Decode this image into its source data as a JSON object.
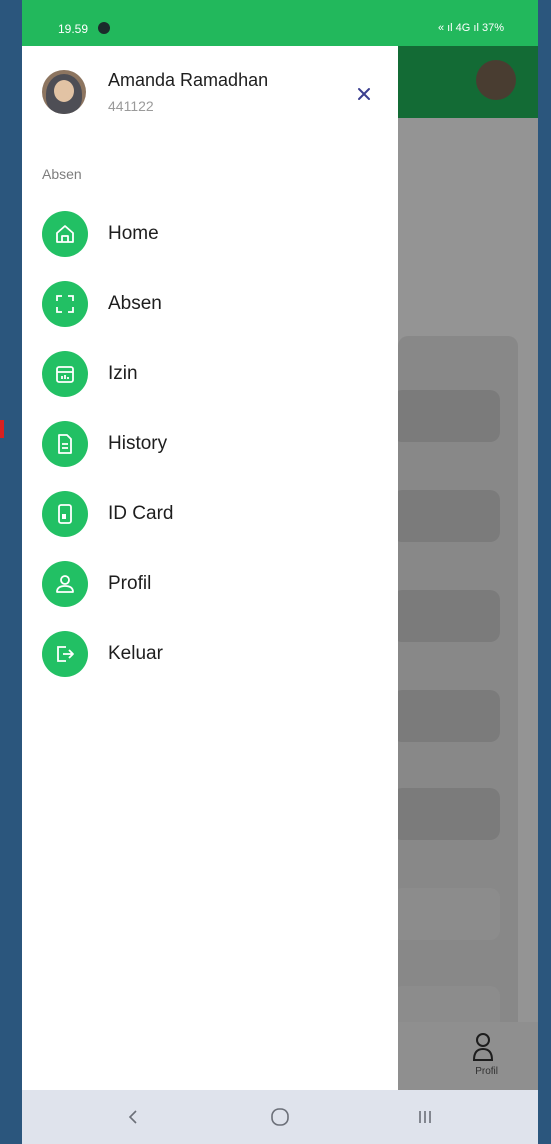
{
  "status_bar": {
    "time": "19.59",
    "indicators": "« ıl 4G ıl 37%"
  },
  "drawer": {
    "user": {
      "name": "Amanda Ramadhan",
      "id": "441122"
    },
    "section_label": "Absen",
    "menu": [
      {
        "label": "Home",
        "icon": "home-icon"
      },
      {
        "label": "Absen",
        "icon": "scan-icon"
      },
      {
        "label": "Izin",
        "icon": "calendar-icon"
      },
      {
        "label": "History",
        "icon": "document-icon"
      },
      {
        "label": "ID Card",
        "icon": "id-card-icon"
      },
      {
        "label": "Profil",
        "icon": "user-icon"
      },
      {
        "label": "Keluar",
        "icon": "logout-icon"
      }
    ]
  },
  "background_app": {
    "bottom_nav_label": "Profil"
  },
  "colors": {
    "accent": "#22c064",
    "status_bar": "#22b85c",
    "nav_bar": "#dfe3ec"
  }
}
